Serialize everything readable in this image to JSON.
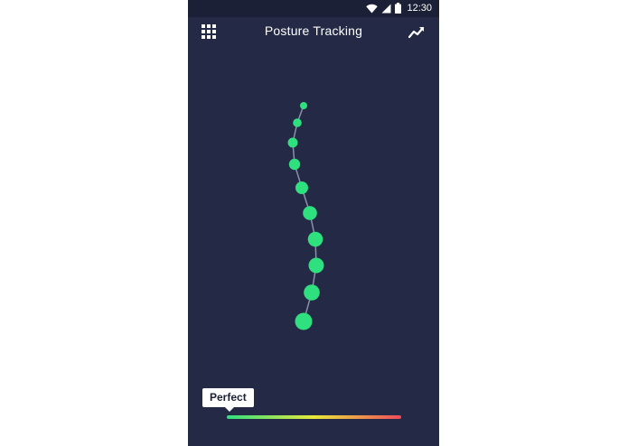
{
  "status_bar": {
    "time": "12:30",
    "icons": [
      "wifi-icon",
      "cell-signal-icon",
      "battery-icon"
    ]
  },
  "app_bar": {
    "title": "Posture Tracking",
    "left_icon": "grid-menu-icon",
    "right_icon": "trend-chart-icon"
  },
  "spine": {
    "vertebra_count": 10,
    "color": "#2fe07f",
    "line_color": "#8a90a8"
  },
  "posture_indicator": {
    "label": "Perfect",
    "gradient_colors": [
      "#2fe07f",
      "#e8e83a",
      "#ef4b5a"
    ]
  },
  "colors": {
    "background": "#242a45",
    "status_bar": "#1b2036",
    "accent": "#2fe07f"
  }
}
